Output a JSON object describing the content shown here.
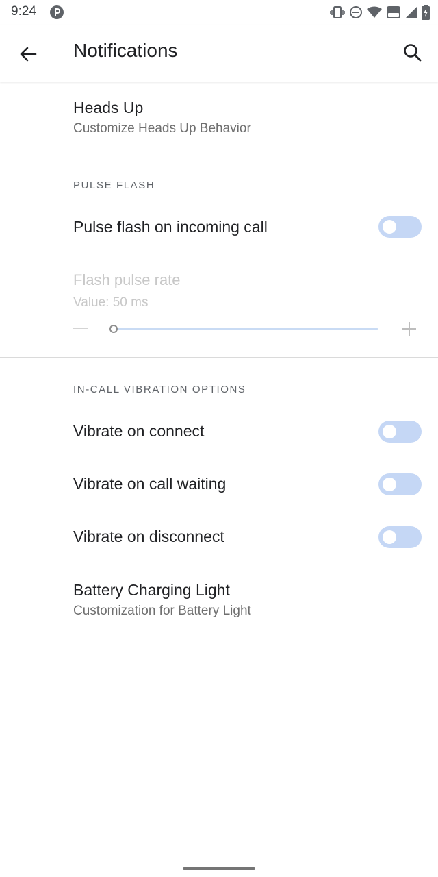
{
  "status_bar": {
    "time": "9:24",
    "icons": [
      "app-badge-icon",
      "vibrate-icon",
      "do-not-disturb-icon",
      "wifi-icon",
      "volte-icon",
      "signal-icon",
      "battery-icon"
    ],
    "volte_label": "Vo\nLTE"
  },
  "toolbar": {
    "title": "Notifications",
    "back_icon": "arrow-back-icon",
    "search_icon": "search-icon"
  },
  "heads_up": {
    "title": "Heads Up",
    "summary": "Customize Heads Up Behavior"
  },
  "pulse_flash": {
    "category": "PULSE FLASH",
    "incoming_call": {
      "label": "Pulse flash on incoming call",
      "enabled": false
    },
    "rate": {
      "title": "Flash pulse rate",
      "value_text": "Value: 50 ms",
      "value_fraction": 0.0,
      "enabled": false
    }
  },
  "in_call_vibration": {
    "category": "IN-CALL VIBRATION OPTIONS",
    "items": [
      {
        "label": "Vibrate on connect",
        "enabled": false
      },
      {
        "label": "Vibrate on call waiting",
        "enabled": false
      },
      {
        "label": "Vibrate on disconnect",
        "enabled": false
      }
    ]
  },
  "battery_light": {
    "title": "Battery Charging Light",
    "summary": "Customization for Battery Light"
  },
  "colors": {
    "toggle_track_off": "#c5d7f5",
    "text_primary": "#202124",
    "text_secondary": "#6f6f6f",
    "disabled_text": "#c8c8c8"
  }
}
